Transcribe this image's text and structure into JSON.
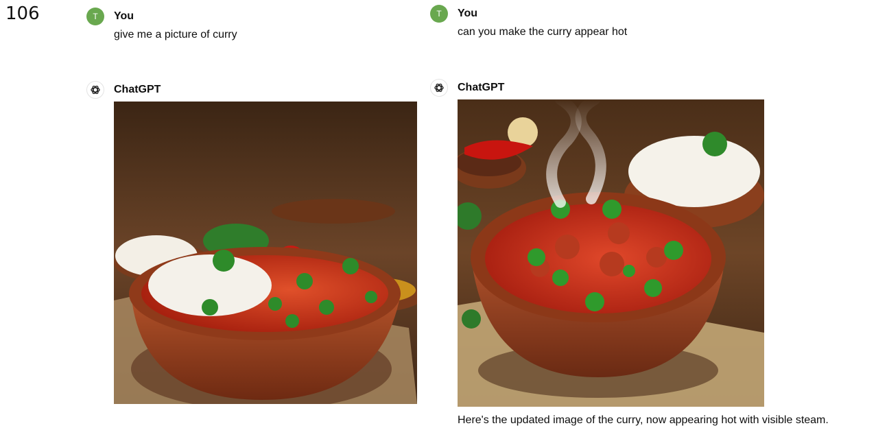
{
  "page_number": "106",
  "left": {
    "user_avatar": "T",
    "user_name": "You",
    "user_message": "give me a picture of curry",
    "assistant_name": "ChatGPT"
  },
  "right": {
    "user_avatar": "T",
    "user_name": "You",
    "user_message": "can you make the curry appear hot",
    "assistant_name": "ChatGPT",
    "assistant_message": "Here's the updated image of the curry, now appearing hot with visible steam."
  },
  "colors": {
    "avatar_bg": "#69a84f",
    "curry_red": "#c8321a",
    "bowl_clay": "#9b4320",
    "wood_bg": "#5a3a22"
  },
  "icons": {
    "assistant": "openai-logo-icon"
  }
}
